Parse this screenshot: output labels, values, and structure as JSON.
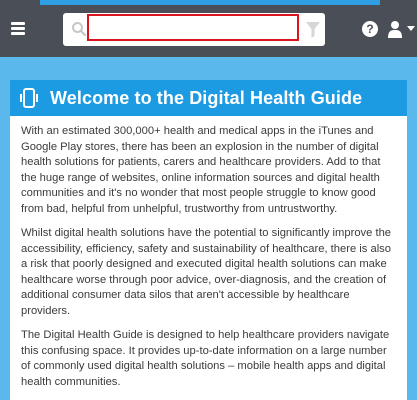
{
  "topbar": {
    "search": {
      "value": "",
      "placeholder": ""
    },
    "icons": {
      "menu": "hamburger-icon",
      "search": "search-icon",
      "filter": "filter-icon",
      "help": "question-circle-icon",
      "user": "user-icon",
      "dropdown": "caret-down-icon"
    },
    "help_glyph": "?"
  },
  "card": {
    "title": "Welcome to the Digital Health Guide",
    "icon": "mobile-device-icon",
    "paragraphs": [
      "With an estimated 300,000+ health and medical apps in the iTunes and Google Play stores, there has been an explosion in the number of digital health solutions for patients, carers and healthcare providers.  Add to that the huge range of websites, online information sources and digital health communities and it's no wonder that most people struggle to know good from bad, helpful from unhelpful, trustworthy from untrustworthy.",
      "Whilst digital health solutions have the potential to significantly improve the accessibility, efficiency, safety and sustainability of healthcare, there is also a risk that poorly designed and executed digital health solutions can make healthcare worse through poor advice, over-diagnosis, and the creation of additional consumer data silos that aren't accessible by healthcare providers.",
      "The Digital Health Guide is designed to help healthcare providers navigate this confusing space.  It provides up-to-date information on a large number of commonly used digital health solutions – mobile health apps and digital health communities."
    ]
  },
  "colors": {
    "navbar": "#4a4f57",
    "accent": "#1d9be2",
    "page_background": "#5bb8ec",
    "search_highlight": "#d9141e"
  }
}
